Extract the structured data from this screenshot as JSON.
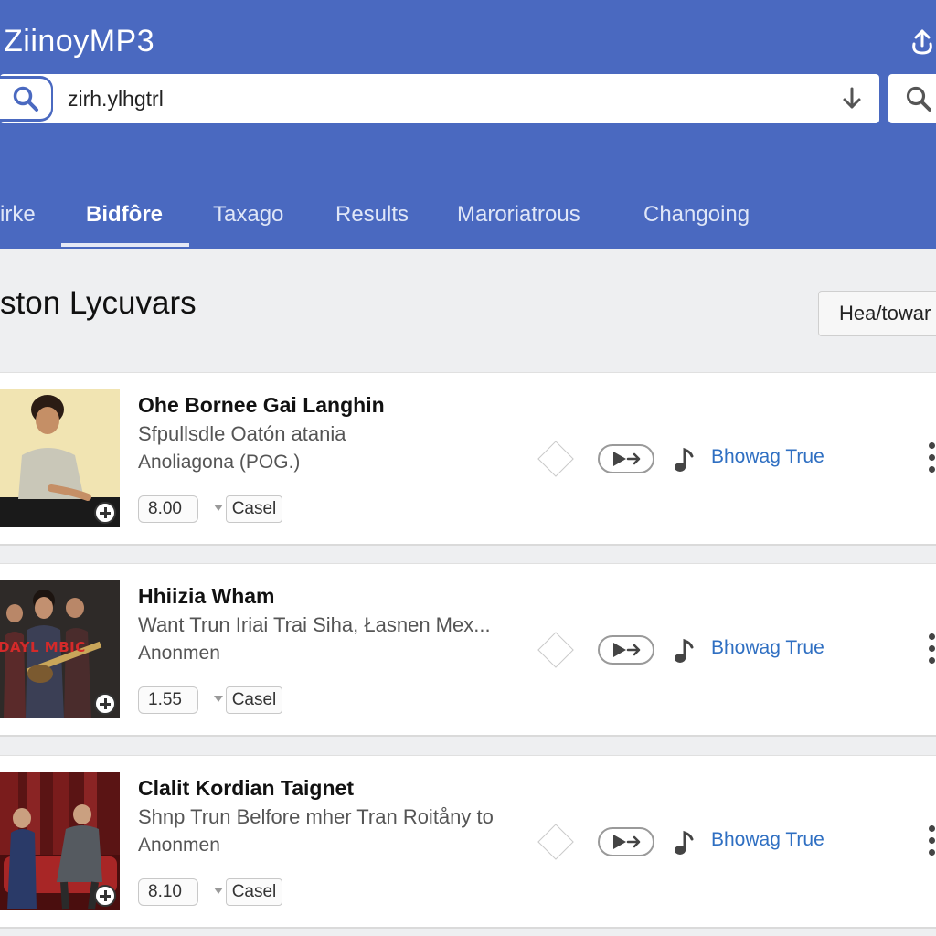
{
  "app": {
    "title": "ZiinoyMP3",
    "upload_icon": "upload-icon"
  },
  "search": {
    "value": "zirh.ylhgtrl",
    "left_icon": "search-icon",
    "download_icon": "download-arrow-icon",
    "right_icon": "search-icon"
  },
  "tabs": [
    {
      "label": "irke",
      "active": false
    },
    {
      "label": "Bidfôre",
      "active": true
    },
    {
      "label": "Taxago",
      "active": false
    },
    {
      "label": "Results",
      "active": false
    },
    {
      "label": "Maroriatrous",
      "active": false
    },
    {
      "label": "Changoing",
      "active": false
    }
  ],
  "section": {
    "title": "ston Lycuvars",
    "button_label": "Hea/towar"
  },
  "results": [
    {
      "title": "Ohe Bornee Gai Langhin",
      "subtitle": "Sfpullsdle Oatón atania",
      "artist": "Anoliagona (POG.)",
      "rating": "8.00",
      "cancel_label": "Casel",
      "link_label": "Bhowag True",
      "thumb_text": ""
    },
    {
      "title": "Hhiizia Wham",
      "subtitle": "Want Trun Iriai Trai Siha, Łasnen Mex...",
      "artist": "Anonmen",
      "rating": "1.55",
      "cancel_label": "Casel",
      "link_label": "Bhowag True",
      "thumb_text": "DAYL MBIC"
    },
    {
      "title": "Clalit Kordian Taignet",
      "subtitle": "Shnp Trun Belfore mher Tran Roitåny to",
      "artist": "Anonmen",
      "rating": "8.10",
      "cancel_label": "Casel",
      "link_label": "Bhowag True",
      "thumb_text": ""
    }
  ],
  "colors": {
    "header": "#4a69c0",
    "link": "#2f6fc2",
    "background": "#eeeff1"
  }
}
